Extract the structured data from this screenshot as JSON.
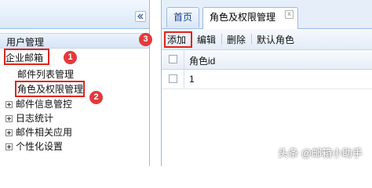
{
  "left": {
    "collapse_icon": "double-chevron-left-icon",
    "section_title": "用户管理",
    "tree": {
      "root_label": "企业邮箱",
      "children": [
        "邮件列表管理",
        "角色及权限管理"
      ],
      "groups": [
        "邮件信息管控",
        "日志统计",
        "邮件相关应用",
        "个性化设置"
      ]
    }
  },
  "tabs": {
    "home_label": "首页",
    "active_label": "角色及权限管理",
    "close_glyph": "x"
  },
  "toolbar": {
    "add_label": "添加",
    "edit_label": "编辑",
    "delete_label": "删除",
    "default_role_label": "默认角色"
  },
  "grid": {
    "header": "角色id",
    "rows": [
      "1"
    ]
  },
  "annotations": {
    "badge_1": "1",
    "badge_2": "2",
    "badge_3": "3",
    "color": "#e1241b"
  },
  "watermark": "头条 @邮箱小助手"
}
